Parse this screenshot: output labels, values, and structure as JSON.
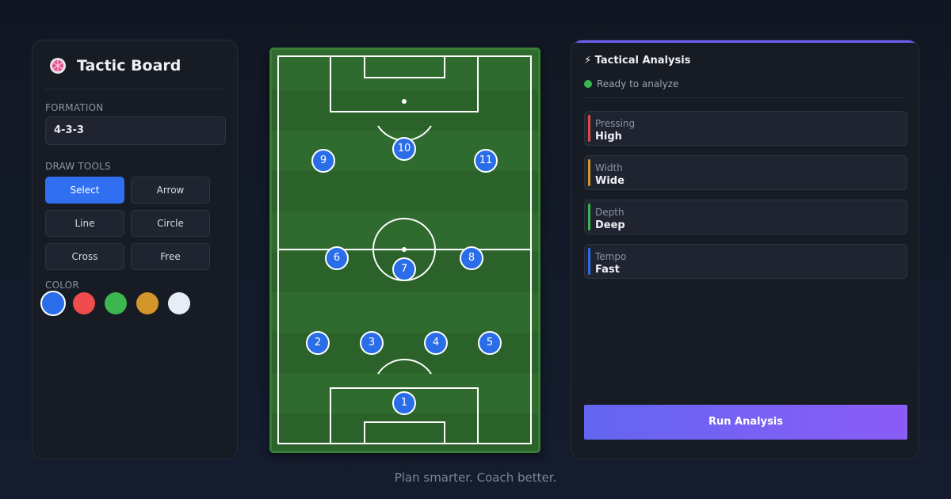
{
  "sidebar": {
    "title": "Tactic Board",
    "formation_label": "FORMATION",
    "formation_value": "4-3-3",
    "draw_tools_label": "DRAW TOOLS",
    "tools": [
      {
        "label": "Select",
        "active": true
      },
      {
        "label": "Arrow",
        "active": false
      },
      {
        "label": "Line",
        "active": false
      },
      {
        "label": "Circle",
        "active": false
      },
      {
        "label": "Cross",
        "active": false
      },
      {
        "label": "Free",
        "active": false
      }
    ],
    "color_label": "COLOR",
    "colors": [
      "#2a6de8",
      "#ef4d4d",
      "#3cb64e",
      "#d4962a",
      "#e8ecf4"
    ],
    "selected_color": "#2a6de8"
  },
  "pitch": {
    "players": [
      "1",
      "2",
      "3",
      "4",
      "5",
      "6",
      "7",
      "8",
      "9",
      "10",
      "11"
    ],
    "player_color": "#2a6de8"
  },
  "analysis": {
    "title": "⚡ Tactical Analysis",
    "status": "Ready to analyze",
    "status_color": "#3cb64e",
    "metrics": [
      {
        "label": "Pressing",
        "value": "High",
        "color": "#e04848"
      },
      {
        "label": "Width",
        "value": "Wide",
        "color": "#d4962a"
      },
      {
        "label": "Depth",
        "value": "Deep",
        "color": "#3cb64e"
      },
      {
        "label": "Tempo",
        "value": "Fast",
        "color": "#2a6de8"
      }
    ],
    "run_button": "Run Analysis"
  },
  "tagline": "Plan smarter. Coach better."
}
